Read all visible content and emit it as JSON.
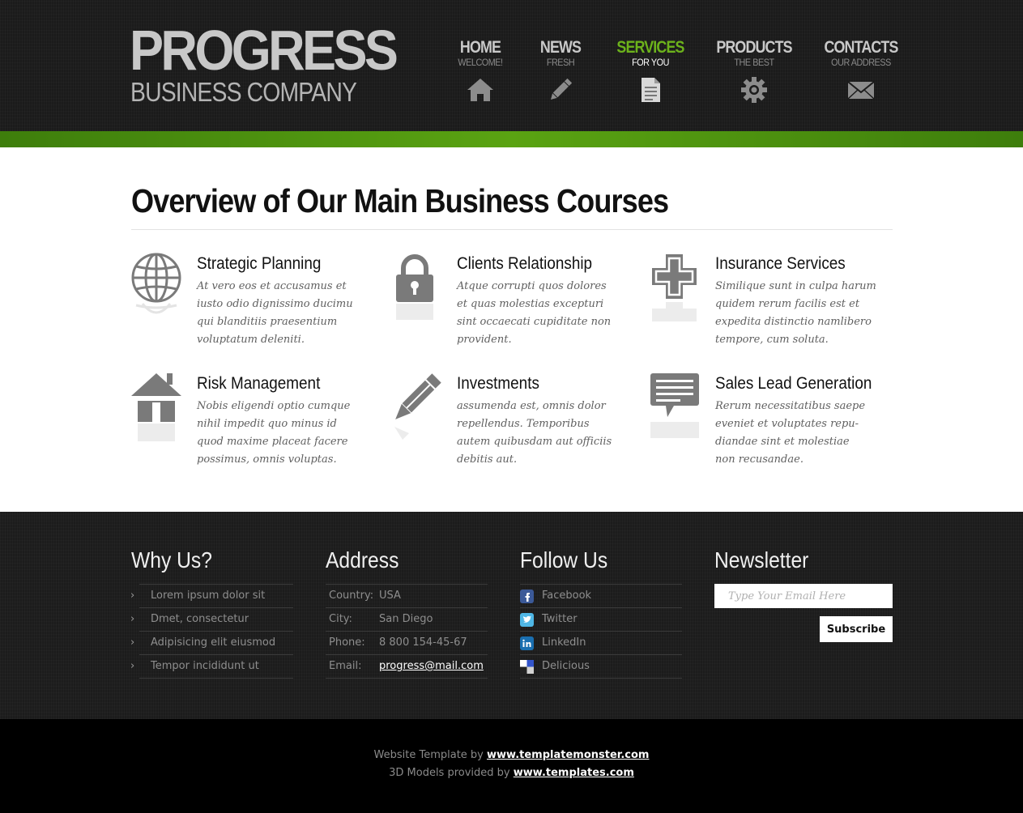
{
  "header": {
    "logo_title": "PROGRESS",
    "logo_subtitle": "BUSINESS COMPANY",
    "nav": [
      {
        "label": "HOME",
        "sub": "WELCOME!",
        "icon": "home-icon"
      },
      {
        "label": "NEWS",
        "sub": "FRESH",
        "icon": "pencil-icon"
      },
      {
        "label": "SERVICES",
        "sub": "FOR YOU",
        "icon": "document-icon",
        "active": true
      },
      {
        "label": "PRODUCTS",
        "sub": "THE BEST",
        "icon": "gear-icon"
      },
      {
        "label": "CONTACTS",
        "sub": "OUR ADDRESS",
        "icon": "envelope-icon"
      }
    ],
    "accent_color": "#6cb21b"
  },
  "main": {
    "title": "Overview of Our Main Business Courses",
    "services": [
      {
        "title": "Strategic Planning",
        "icon": "globe-icon",
        "lines": [
          "At vero eos et accusamus et",
          "iusto odio dignissimo ducimu",
          "qui blanditiis praesentium",
          "voluptatum deleniti."
        ]
      },
      {
        "title": "Clients Relationship",
        "icon": "lock-icon",
        "lines": [
          "Atque corrupti quos dolores",
          "et quas molestias excepturi",
          "sint occaecati cupiditate non",
          "provident."
        ]
      },
      {
        "title": "Insurance Services",
        "icon": "medical-cross-icon",
        "lines": [
          "Similique sunt in culpa harum",
          "quidem rerum facilis est et",
          "expedita distinctio namlibero",
          "tempore, cum soluta."
        ]
      },
      {
        "title": "Risk Management",
        "icon": "house-icon",
        "lines": [
          "Nobis eligendi optio cumque",
          "nihil impedit quo minus id",
          "quod maxime placeat facere",
          "possimus, omnis voluptas."
        ]
      },
      {
        "title": "Investments",
        "icon": "pencil-icon",
        "lines": [
          "assumenda est, omnis dolor",
          "repellendus. Temporibus",
          "autem quibusdam aut officiis",
          "debitis aut."
        ]
      },
      {
        "title": "Sales Lead Generation",
        "icon": "speech-bubble-icon",
        "lines": [
          "Rerum necessitatibus saepe",
          "eveniet et voluptates repu-",
          "diandae sint et molestiae",
          "non recusandae."
        ]
      }
    ]
  },
  "footer": {
    "why": {
      "heading": "Why Us?",
      "items": [
        "Lorem ipsum dolor sit",
        "Dmet, consectetur",
        "Adipisicing elit eiusmod",
        "Tempor incididunt ut"
      ]
    },
    "address": {
      "heading": "Address",
      "rows": [
        {
          "k": "Country:",
          "v": "USA"
        },
        {
          "k": "City:",
          "v": "San Diego"
        },
        {
          "k": "Phone:",
          "v": "8 800 154-45-67"
        },
        {
          "k": "Email:",
          "v": "progress@mail.com"
        }
      ]
    },
    "follow": {
      "heading": "Follow Us",
      "items": [
        {
          "label": "Facebook",
          "icon": "facebook-icon",
          "color": "#3b5998"
        },
        {
          "label": "Twitter",
          "icon": "twitter-icon",
          "color": "#4fb7e6"
        },
        {
          "label": "LinkedIn",
          "icon": "linkedin-icon",
          "color": "#1a6fb0"
        },
        {
          "label": "Delicious",
          "icon": "delicious-icon",
          "color": "#3355cc"
        }
      ]
    },
    "newsletter": {
      "heading": "Newsletter",
      "placeholder": "Type Your Email Here",
      "button": "Subscribe"
    }
  },
  "credits": {
    "line1_text": "Website Template by ",
    "line1_link": "www.templatemonster.com",
    "line2_text": "3D Models provided by ",
    "line2_link": "www.templates.com"
  }
}
